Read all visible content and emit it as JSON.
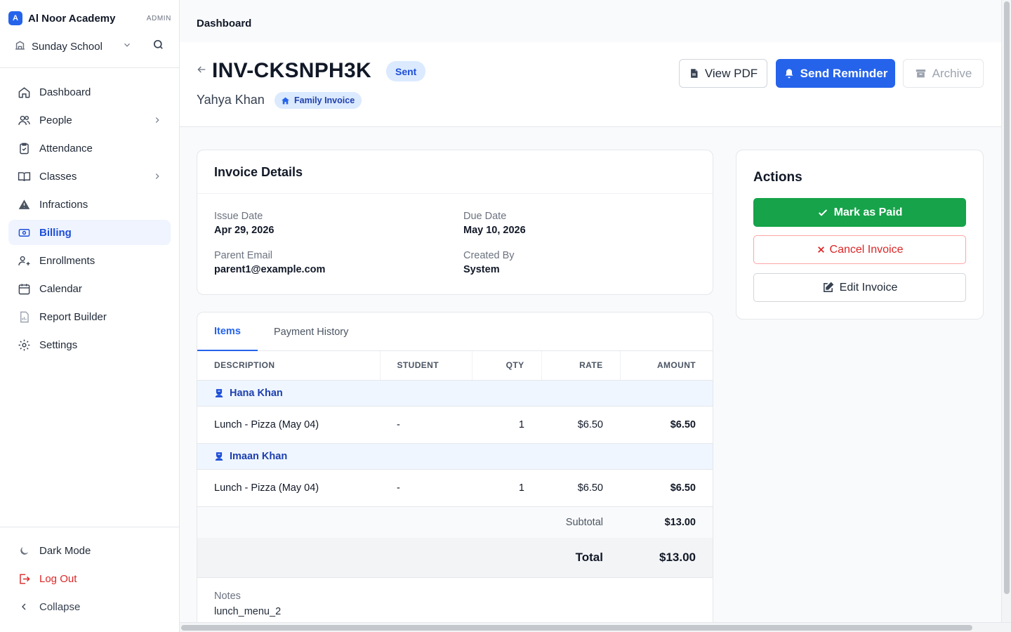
{
  "brand": {
    "logo_letter": "A",
    "name": "Al Noor Academy",
    "role": "ADMIN"
  },
  "school": {
    "selected": "Sunday School"
  },
  "nav": {
    "items": [
      {
        "label": "Dashboard",
        "icon": "home-icon"
      },
      {
        "label": "People",
        "icon": "users-icon",
        "expandable": true
      },
      {
        "label": "Attendance",
        "icon": "clipboard-check-icon"
      },
      {
        "label": "Classes",
        "icon": "book-open-icon",
        "expandable": true
      },
      {
        "label": "Infractions",
        "icon": "warning-icon"
      },
      {
        "label": "Billing",
        "icon": "billing-icon",
        "active": true
      },
      {
        "label": "Enrollments",
        "icon": "user-plus-icon"
      },
      {
        "label": "Calendar",
        "icon": "calendar-icon"
      },
      {
        "label": "Report Builder",
        "icon": "report-icon"
      },
      {
        "label": "Settings",
        "icon": "gear-icon"
      }
    ],
    "bottom": {
      "dark_mode": "Dark Mode",
      "logout": "Log Out",
      "collapse": "Collapse"
    }
  },
  "breadcrumb": "Dashboard",
  "invoice": {
    "number": "INV-CKSNPH3K",
    "status": "Sent",
    "parent_name": "Yahya Khan",
    "type_badge": "Family Invoice"
  },
  "header_buttons": {
    "view_pdf": "View PDF",
    "send_reminder": "Send Reminder",
    "archive": "Archive"
  },
  "details": {
    "title": "Invoice Details",
    "issue_date_label": "Issue Date",
    "issue_date": "Apr 29, 2026",
    "due_date_label": "Due Date",
    "due_date": "May 10, 2026",
    "parent_email_label": "Parent Email",
    "parent_email": "parent1@example.com",
    "created_by_label": "Created By",
    "created_by": "System"
  },
  "tabs": {
    "items": "Items",
    "payment_history": "Payment History"
  },
  "table": {
    "columns": {
      "description": "DESCRIPTION",
      "student": "STUDENT",
      "qty": "QTY",
      "rate": "RATE",
      "amount": "AMOUNT"
    },
    "groups": [
      {
        "student": "Hana Khan",
        "rows": [
          {
            "description": "Lunch - Pizza (May 04)",
            "student": "-",
            "qty": "1",
            "rate": "$6.50",
            "amount": "$6.50"
          }
        ]
      },
      {
        "student": "Imaan Khan",
        "rows": [
          {
            "description": "Lunch - Pizza (May 04)",
            "student": "-",
            "qty": "1",
            "rate": "$6.50",
            "amount": "$6.50"
          }
        ]
      }
    ],
    "subtotal_label": "Subtotal",
    "subtotal": "$13.00",
    "total_label": "Total",
    "total": "$13.00"
  },
  "notes": {
    "label": "Notes",
    "value": "lunch_menu_2"
  },
  "actions": {
    "title": "Actions",
    "mark_paid": "Mark as Paid",
    "cancel": "Cancel Invoice",
    "edit": "Edit Invoice"
  },
  "colors": {
    "primary": "#2563eb",
    "success": "#16a34a",
    "danger": "#dc2626",
    "active_bg": "#eff4ff"
  }
}
